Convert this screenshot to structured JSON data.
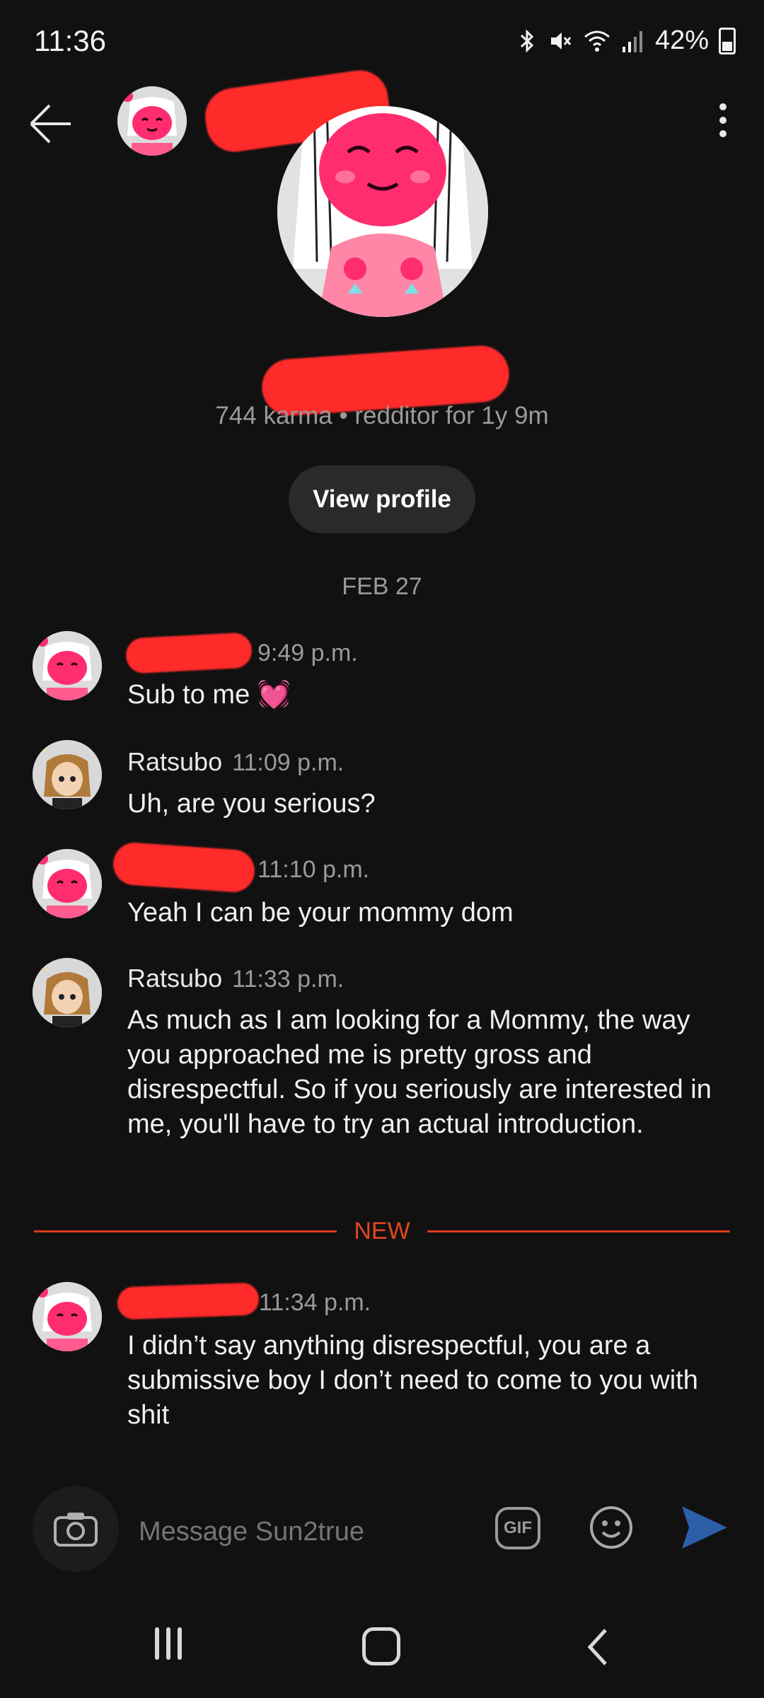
{
  "status_bar": {
    "time": "11:36",
    "battery_percent": "42%",
    "icons": [
      "bluetooth-icon",
      "mute-icon",
      "wifi-icon",
      "signal-icon",
      "battery-icon"
    ]
  },
  "header": {
    "back_icon": "arrow-left-icon",
    "menu_icon": "kebab-icon"
  },
  "profile": {
    "karma_line": "744 karma • redditor for 1y 9m",
    "view_profile_label": "View profile"
  },
  "date_separator": "FEB 27",
  "messages": [
    {
      "author": "",
      "time": "9:49 p.m.",
      "text": "Sub to me 💓"
    },
    {
      "author": "Ratsubo",
      "time": "11:09 p.m.",
      "text": "Uh, are you serious?"
    },
    {
      "author": "",
      "time": "11:10 p.m.",
      "text": "Yeah I can be your mommy dom"
    },
    {
      "author": "Ratsubo",
      "time": "11:33 p.m.",
      "text": "As much as I am looking for a Mommy, the way you approached me is pretty gross and disrespectful. So if you seriously are interested in me, you'll have to try an actual introduction."
    },
    {
      "author": "",
      "time": "11:34 p.m.",
      "text": "I didn’t say anything disrespectful, you are a submissive boy I don’t need to come to you with shit"
    }
  ],
  "new_divider_label": "NEW",
  "composer": {
    "placeholder": "Message Sun2true",
    "gif_label": "GIF"
  },
  "colors": {
    "background": "#111111",
    "accent_new": "#e0461f",
    "send": "#2d5ea8",
    "redaction": "#ff2a2a"
  }
}
